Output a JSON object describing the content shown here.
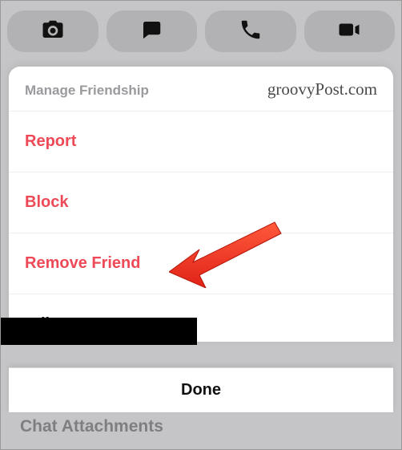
{
  "toolbar": {
    "icons": [
      "camera-icon",
      "chat-icon",
      "phone-icon",
      "video-icon"
    ]
  },
  "sheet": {
    "title": "Manage Friendship",
    "watermark": "groovyPost.com",
    "items": [
      {
        "label": "Report",
        "style": "danger"
      },
      {
        "label": "Block",
        "style": "danger"
      },
      {
        "label": "Remove Friend",
        "style": "danger"
      },
      {
        "label": "Edit Name",
        "style": "normal"
      }
    ]
  },
  "done_button": {
    "label": "Done"
  },
  "background_partial_text": "Chat Attachments",
  "annotation": {
    "arrow_color": "#ff3b30",
    "points_to": "Remove Friend"
  }
}
